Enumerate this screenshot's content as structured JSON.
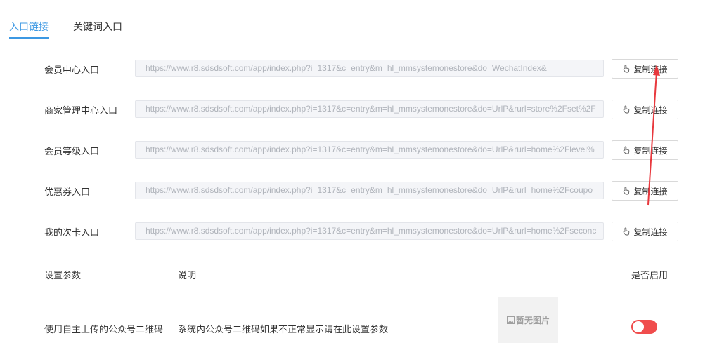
{
  "tabs": [
    {
      "label": "入口链接",
      "active": true
    },
    {
      "label": "关键词入口",
      "active": false
    }
  ],
  "link_rows": [
    {
      "label": "会员中心入口",
      "url": "https://www.r8.sdsdsoft.com/app/index.php?i=1317&c=entry&m=hl_mmsystemonestore&do=WechatIndex&",
      "button": "复制连接"
    },
    {
      "label": "商家管理中心入口",
      "url": "https://www.r8.sdsdsoft.com/app/index.php?i=1317&c=entry&m=hl_mmsystemonestore&do=UrlP&rurl=store%2Fset%2F",
      "button": "复制连接"
    },
    {
      "label": "会员等级入口",
      "url": "https://www.r8.sdsdsoft.com/app/index.php?i=1317&c=entry&m=hl_mmsystemonestore&do=UrlP&rurl=home%2Flevel%",
      "button": "复制连接"
    },
    {
      "label": "优惠券入口",
      "url": "https://www.r8.sdsdsoft.com/app/index.php?i=1317&c=entry&m=hl_mmsystemonestore&do=UrlP&rurl=home%2Fcoupo",
      "button": "复制连接"
    },
    {
      "label": "我的次卡入口",
      "url": "https://www.r8.sdsdsoft.com/app/index.php?i=1317&c=entry&m=hl_mmsystemonestore&do=UrlP&rurl=home%2Fseconc",
      "button": "复制连接"
    }
  ],
  "settings": {
    "headers": {
      "param": "设置参数",
      "desc": "说明",
      "enabled": "是否启用"
    },
    "rows": [
      {
        "param": "使用自主上传的公众号二维码",
        "desc": "系统内公众号二维码如果不正常显示请在此设置参数",
        "image_placeholder": "暂无图片",
        "enabled": false
      }
    ]
  },
  "colors": {
    "accent": "#3c98e3",
    "toggle_off": "#f04d4d",
    "annotation_arrow": "#e8383d"
  }
}
